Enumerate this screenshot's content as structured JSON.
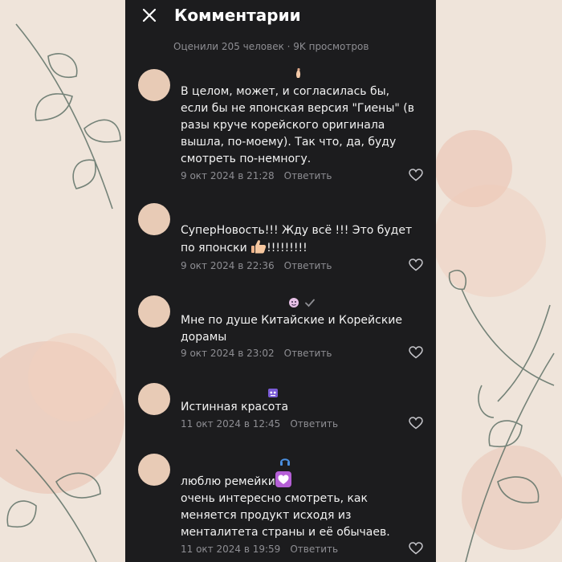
{
  "header": {
    "title": "Комментарии",
    "stats": "Оценили 205 человек · 9K просмотров"
  },
  "comments": [
    {
      "lines": "В целом, может, и согласилась бы,\nесли бы не японская версия \"Гиены\" (в\nразы круче корейского оригинала\nвышла, по-моему). Так что, да, буду\nсмотреть по-немногу.",
      "date": "9 окт 2024 в 21:28",
      "reply": "Ответить",
      "badge_icon": "pinched-fingers-icon"
    },
    {
      "text_before": "СуперНовость!!! Жду всё !!! Это будет\nпо японски ",
      "text_after": "!!!!!!!!!",
      "inline_icon": "thumbs-up-icon",
      "date": "9 окт 2024 в 22:36",
      "reply": "Ответить"
    },
    {
      "lines": "Мне  по душе Китайские и Корейские\nдорамы",
      "date": "9 окт 2024 в 23:02",
      "reply": "Ответить",
      "badge_icon": "sparkle-face-icon",
      "verified_icon": "checkmark-icon"
    },
    {
      "lines": "Истинная красота",
      "date": "11 окт 2024 в 12:45",
      "reply": "Ответить",
      "badge_icon": "robot-face-icon"
    },
    {
      "text_before": "люблю ремейки",
      "inline_icon": "white-heart-icon",
      "lines": "очень интересно смотреть, как\nменяется продукт исходя из\nменталитета страны и её обычаев.",
      "date": "11 окт 2024 в 19:59",
      "reply": "Ответить",
      "badge_icon": "headphones-icon"
    }
  ],
  "colors": {
    "background": "#efe4da",
    "panel": "#1c1c1e",
    "avatar": "#e8cbb6",
    "muted_text": "#8e8e93",
    "text": "#f2f2f2"
  }
}
